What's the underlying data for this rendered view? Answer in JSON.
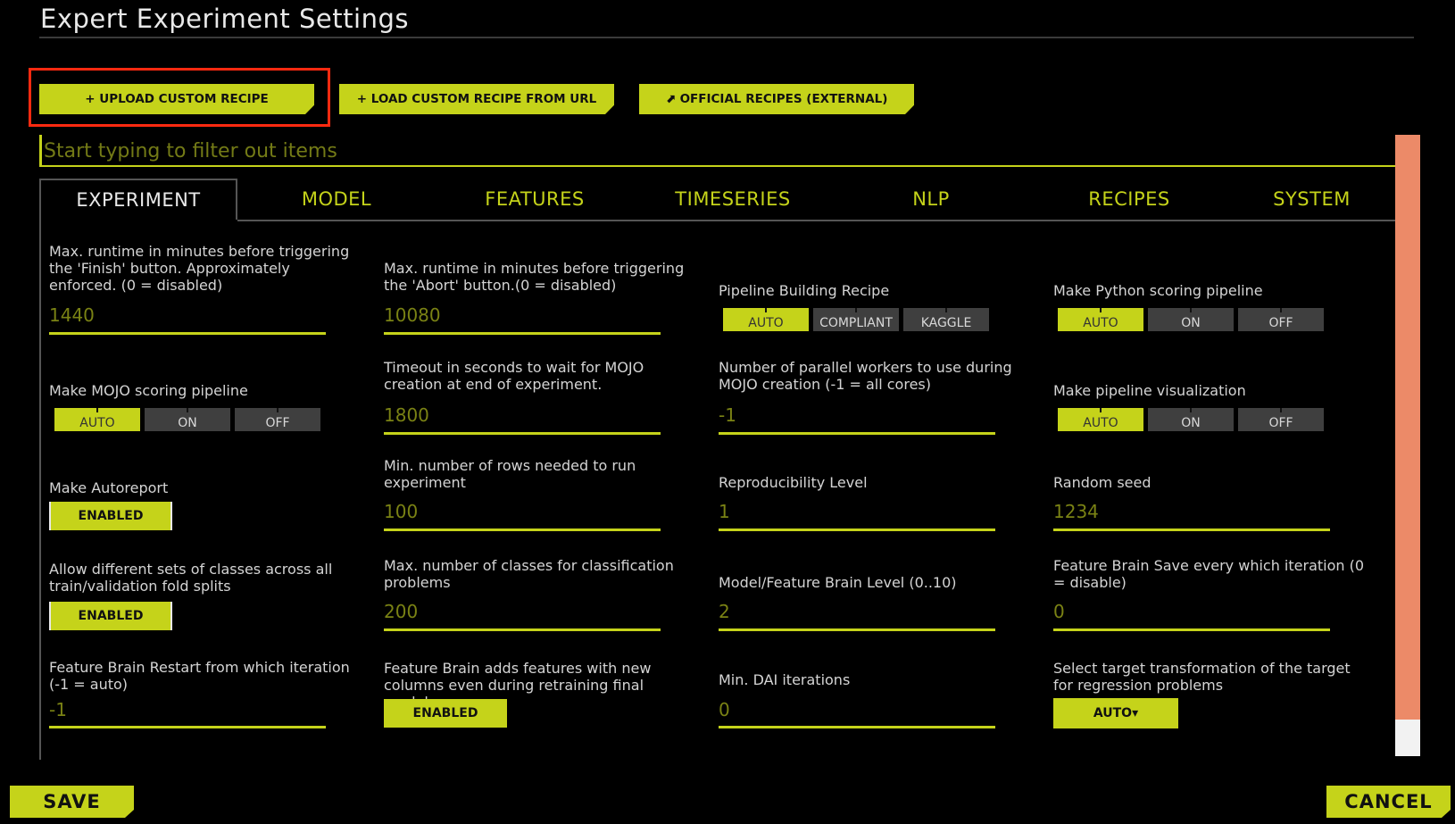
{
  "header": {
    "title": "Expert Experiment Settings"
  },
  "recipe_buttons": {
    "upload": "+ UPLOAD CUSTOM RECIPE",
    "load_url": "+ LOAD CUSTOM RECIPE FROM URL",
    "official": "⬈ OFFICIAL RECIPES (EXTERNAL)"
  },
  "filter": {
    "placeholder": "Start typing to filter out items"
  },
  "tabs": [
    "EXPERIMENT",
    "MODEL",
    "FEATURES",
    "TIMESERIES",
    "NLP",
    "RECIPES",
    "SYSTEM"
  ],
  "settings": {
    "max_runtime_finish": {
      "label": "Max. runtime in minutes before triggering the 'Finish' button. Approximately enforced. (0 = disabled)",
      "value": "1440"
    },
    "max_runtime_abort": {
      "label": "Max. runtime in minutes before triggering the 'Abort' button.(0 = disabled)",
      "value": "10080"
    },
    "pipeline_recipe": {
      "label": "Pipeline Building Recipe",
      "options": [
        "AUTO",
        "COMPLIANT",
        "KAGGLE"
      ],
      "selected": "AUTO"
    },
    "python_pipeline": {
      "label": "Make Python scoring pipeline",
      "options": [
        "AUTO",
        "ON",
        "OFF"
      ],
      "selected": "AUTO"
    },
    "mojo_pipeline": {
      "label": "Make MOJO scoring pipeline",
      "options": [
        "AUTO",
        "ON",
        "OFF"
      ],
      "selected": "AUTO"
    },
    "mojo_timeout": {
      "label": "Timeout in seconds to wait for MOJO creation at end of experiment.",
      "value": "1800"
    },
    "mojo_workers": {
      "label": "Number of parallel workers to use during MOJO creation (-1 = all cores)",
      "value": "-1"
    },
    "pipeline_viz": {
      "label": "Make pipeline visualization",
      "options": [
        "AUTO",
        "ON",
        "OFF"
      ],
      "selected": "AUTO"
    },
    "autoreport": {
      "label": "Make Autoreport",
      "state": "ENABLED"
    },
    "min_rows": {
      "label": "Min. number of rows needed to run experiment",
      "value": "100"
    },
    "reproducibility": {
      "label": "Reproducibility Level",
      "value": "1"
    },
    "random_seed": {
      "label": "Random seed",
      "value": "1234"
    },
    "diff_classes": {
      "label": "Allow different sets of classes across all train/validation fold splits",
      "state": "ENABLED"
    },
    "max_classes": {
      "label": "Max. number of classes for classification problems",
      "value": "200"
    },
    "brain_level": {
      "label": "Model/Feature Brain Level (0..10)",
      "value": "2"
    },
    "brain_save": {
      "label": "Feature Brain Save every which iteration (0 = disable)",
      "value": "0"
    },
    "brain_restart": {
      "label": "Feature Brain Restart from which iteration (-1 = auto)",
      "value": "-1"
    },
    "brain_new_cols": {
      "label": "Feature Brain adds features with new columns even during retraining final model",
      "state": "ENABLED"
    },
    "min_dai_iter": {
      "label": "Min. DAI iterations",
      "value": "0"
    },
    "target_transform": {
      "label": "Select target transformation of the target for regression problems",
      "value": "AUTO▾"
    }
  },
  "footer": {
    "save": "SAVE",
    "cancel": "CANCEL"
  },
  "colors": {
    "accent": "#c5d31a",
    "highlight": "#ff2a10",
    "scrollbar": "#ec8a68"
  }
}
